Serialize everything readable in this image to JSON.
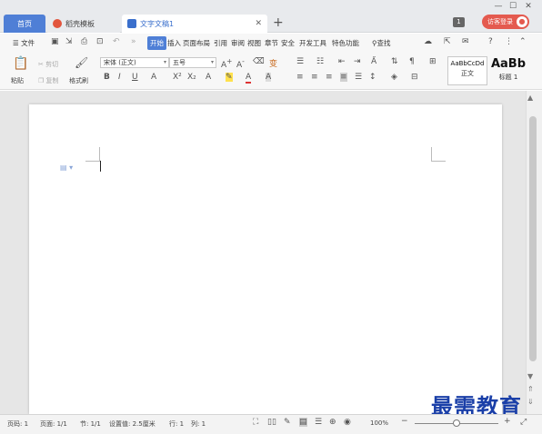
{
  "tabs": {
    "home": "首页",
    "template": "稻壳模板",
    "doc": "文字文稿1",
    "badge": "1",
    "login": "访客登录"
  },
  "window_controls": [
    "—",
    "☐",
    "✕"
  ],
  "menu": {
    "file": "文件",
    "items": [
      "开始",
      "插入",
      "页面布局",
      "引用",
      "审阅",
      "视图",
      "章节",
      "安全",
      "开发工具",
      "特色功能"
    ],
    "active": "开始",
    "search": "查找"
  },
  "ribbon": {
    "paste": "粘贴",
    "cut": "剪切",
    "copy": "复制",
    "format_painter": "格式刷",
    "font_name": "宋体 (正文)",
    "font_size": "五号",
    "style_normal_sample": "AaBbCcDd",
    "style_normal": "正文",
    "style_heading_sample": "AaBb",
    "style_heading": "标题 1"
  },
  "status": {
    "page_no": "页码: 1",
    "pages": "页面: 1/1",
    "section": "节: 1/1",
    "setting": "设置值: 2.5厘米",
    "row": "行: 1",
    "col": "列: 1",
    "zoom": "100%"
  },
  "watermark": "最需教育"
}
